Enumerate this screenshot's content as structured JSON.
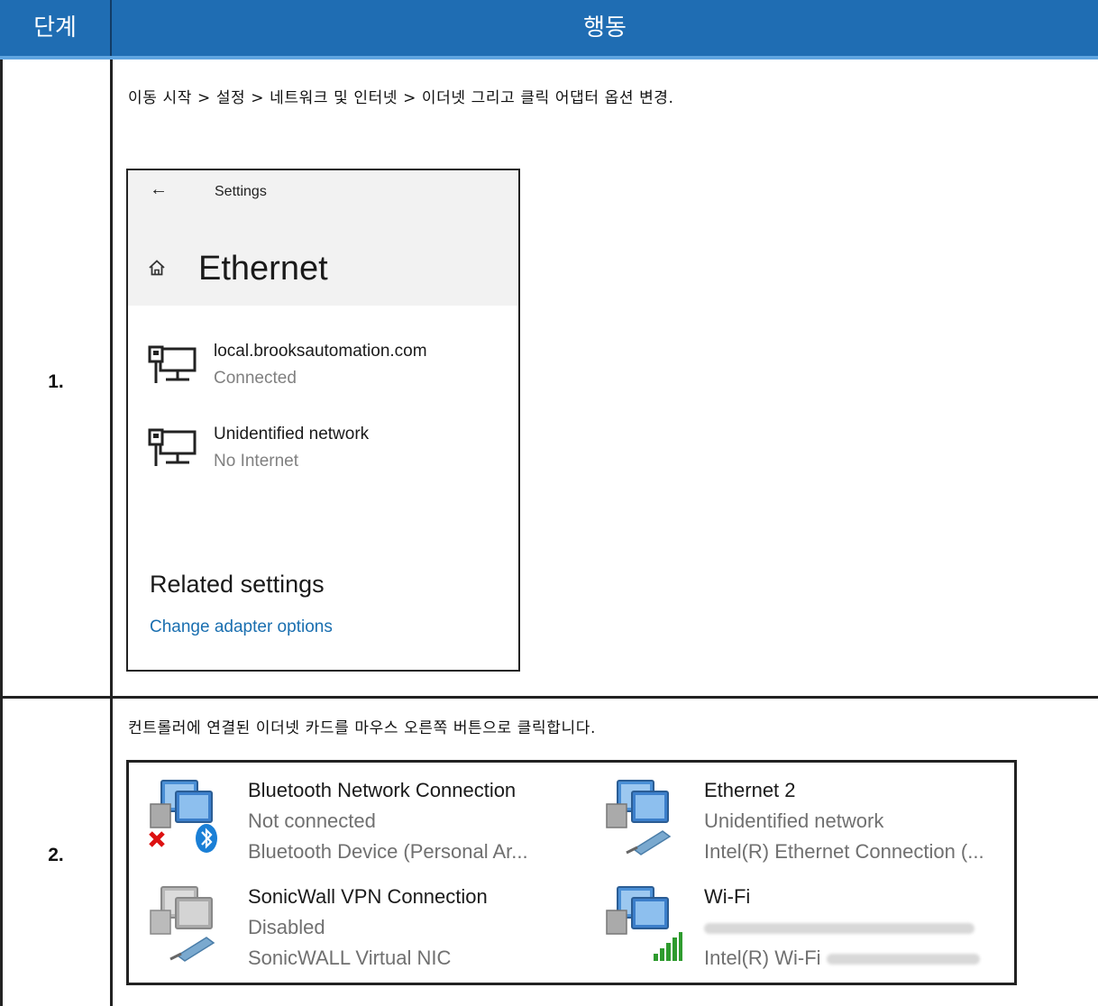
{
  "table": {
    "headers": [
      "단계",
      "행동"
    ]
  },
  "steps": [
    {
      "number": "1.",
      "instruction": "이동 시작 > 설정 > 네트워크 및 인터넷 > 이더넷 그리고 클릭 어댑터 옵션 변경.",
      "screenshot": {
        "back_icon": "arrow-left-icon",
        "header_label": "Settings",
        "home_icon": "home-icon",
        "title": "Ethernet",
        "networks": [
          {
            "name": "local.brooksautomation.com",
            "status": "Connected",
            "icon": "network-pc-icon"
          },
          {
            "name": "Unidentified network",
            "status": "No Internet",
            "icon": "network-pc-icon"
          }
        ],
        "related_heading": "Related settings",
        "related_link": "Change adapter options",
        "link_color": "#1a6fb0"
      }
    },
    {
      "number": "2.",
      "instruction": "컨트롤러에 연결된 이더넷 카드를 마우스 오른쪽 버튼으로 클릭합니다.",
      "screenshot": {
        "connections": [
          {
            "name": "Bluetooth Network Connection",
            "status": "Not connected",
            "device": "Bluetooth Device (Personal Ar...",
            "icon": "bluetooth-adapter-icon"
          },
          {
            "name": "Ethernet 2",
            "status": "Unidentified network",
            "device": "Intel(R) Ethernet Connection (...",
            "icon": "ethernet-adapter-icon"
          },
          {
            "name": "SonicWall VPN Connection",
            "status": "Disabled",
            "device": "SonicWALL Virtual NIC",
            "icon": "vpn-adapter-icon"
          },
          {
            "name": "Wi-Fi",
            "status": "",
            "device": "Intel(R) Wi-Fi",
            "icon": "wifi-adapter-icon"
          }
        ]
      }
    }
  ],
  "colors": {
    "header_bg": "#1f6db3",
    "header_underline": "#5fa4e0",
    "header_text": "#ffffff"
  }
}
